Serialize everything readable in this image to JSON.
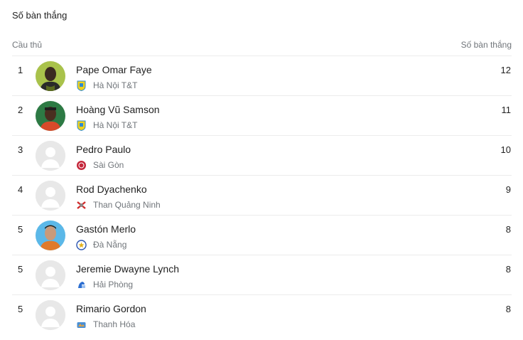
{
  "title": "Số bàn thắng",
  "header": {
    "player_col": "Cầu thủ",
    "goals_col": "Số bàn thắng"
  },
  "colors": {
    "placeholder_avatar": "#e8e8e8",
    "placeholder_figure": "#ffffff",
    "divider": "#ececec",
    "secondary_text": "#70757a"
  },
  "players": [
    {
      "rank": "1",
      "name": "Pape Omar Faye",
      "club": "Hà Nội T&T",
      "club_icon": "ha-noi-crest-icon",
      "goals": "12",
      "avatar": "photo"
    },
    {
      "rank": "2",
      "name": "Hoàng Vũ Samson",
      "club": "Hà Nội T&T",
      "club_icon": "ha-noi-crest-icon",
      "goals": "11",
      "avatar": "photo"
    },
    {
      "rank": "3",
      "name": "Pedro Paulo",
      "club": "Sài Gòn",
      "club_icon": "sai-gon-crest-icon",
      "goals": "10",
      "avatar": "placeholder"
    },
    {
      "rank": "4",
      "name": "Rod Dyachenko",
      "club": "Than Quảng Ninh",
      "club_icon": "than-quang-ninh-crest-icon",
      "goals": "9",
      "avatar": "placeholder"
    },
    {
      "rank": "5",
      "name": "Gastón Merlo",
      "club": "Đà Nẵng",
      "club_icon": "da-nang-crest-icon",
      "goals": "8",
      "avatar": "photo"
    },
    {
      "rank": "5",
      "name": "Jeremie Dwayne Lynch",
      "club": "Hải Phòng",
      "club_icon": "hai-phong-crest-icon",
      "goals": "8",
      "avatar": "placeholder"
    },
    {
      "rank": "5",
      "name": "Rimario Gordon",
      "club": "Thanh Hóa",
      "club_icon": "thanh-hoa-crest-icon",
      "goals": "8",
      "avatar": "placeholder"
    }
  ]
}
